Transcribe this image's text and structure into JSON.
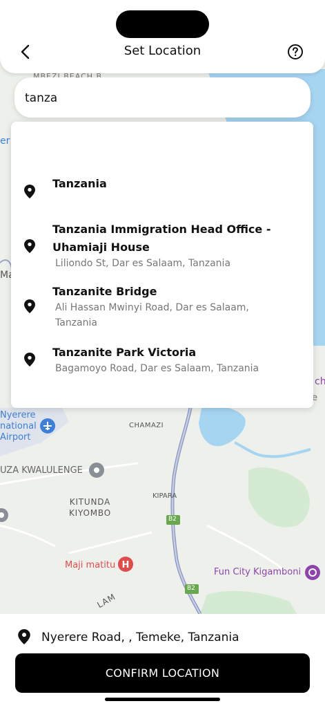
{
  "header": {
    "title": "Set Location",
    "back_icon": "chevron-left-icon",
    "help_icon": "help-circle-icon"
  },
  "search": {
    "value": "tanza",
    "placeholder": ""
  },
  "results": [
    {
      "name": "Tanzania",
      "address": ""
    },
    {
      "name": "Tanzania Immigration Head Office - Uhamiaji House",
      "address": "Liliondo St,  Dar es Salaam,  Tanzania"
    },
    {
      "name": "Tanzanite Bridge",
      "address": "Ali Hassan Mwinyi Road,  Dar es Salaam,  Tanzania"
    },
    {
      "name": "Tanzanite Park Victoria",
      "address": "Bagamoyo Road,  Dar es Salaam,  Tanzania"
    }
  ],
  "map": {
    "labels": {
      "top_partial": "MBEZI BEACH B",
      "left_partial_1": "er",
      "left_partial_2": "Ma",
      "right_partial_1": "ch",
      "right_partial_2": "e",
      "airport": "Nyerere\nnational\nAirport",
      "chamazi": "CHAMAZI",
      "kwalulenge": "UZA KWALULENGE",
      "kitunda": "KITUNDA\nKIYOMBO",
      "kipara": "KIPARA",
      "maji_matitu": "Maji matitu",
      "fun_city": "Fun City Kigamboni",
      "road_b2_1": "B2",
      "road_b2_2": "B2",
      "bottom_partial": "LAM"
    },
    "colors": {
      "water": "#a6d5f2",
      "land": "#eef0ec",
      "green": "#cfe8cf",
      "road": "#9aa4c4",
      "shield": "#6aa84f",
      "pink_poi": "#e04c4c",
      "purple_poi": "#8e44ad",
      "airport_blue": "#3d7fd9"
    }
  },
  "bottom": {
    "address": "Nyerere Road, , Temeke, Tanzania",
    "confirm_label": "CONFIRM LOCATION"
  }
}
